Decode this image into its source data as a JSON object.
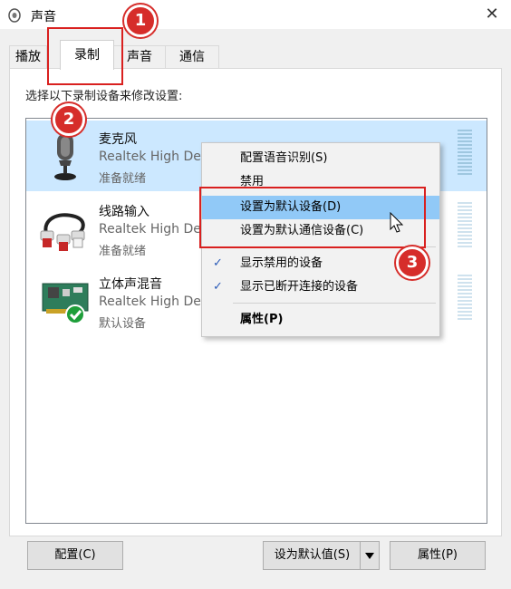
{
  "window": {
    "title": "声音",
    "close_glyph": "✕",
    "icon": "speaker-icon"
  },
  "tabs": [
    {
      "label": "播放",
      "active": false
    },
    {
      "label": "录制",
      "active": true
    },
    {
      "label": "声音",
      "active": false
    },
    {
      "label": "通信",
      "active": false
    }
  ],
  "instruction": "选择以下录制设备来修改设置:",
  "devices": [
    {
      "name": "麦克风",
      "description": "Realtek High Definition Audio",
      "status": "准备就绪",
      "icon": "microphone-icon",
      "selected": true
    },
    {
      "name": "线路输入",
      "description": "Realtek High Definition Audio",
      "status": "准备就绪",
      "icon": "line-in-cable-icon",
      "selected": false
    },
    {
      "name": "立体声混音",
      "description": "Realtek High Definition Audio",
      "status": "默认设备",
      "icon": "sound-card-icon",
      "selected": false,
      "default_check": true
    }
  ],
  "context_menu": {
    "items": [
      {
        "label": "配置语音识别(S)"
      },
      {
        "label": "禁用"
      },
      {
        "label": "设置为默认设备(D)",
        "highlighted": true
      },
      {
        "label": "设置为默认通信设备(C)"
      },
      {
        "label": "显示禁用的设备",
        "checked": true
      },
      {
        "label": "显示已断开连接的设备",
        "checked": true
      },
      {
        "label": "属性(P)",
        "bold": true
      }
    ],
    "check_glyph": "✓"
  },
  "buttons": {
    "configure": "配置(C)",
    "set_default": "设为默认值(S)",
    "properties": "属性(P)"
  },
  "annotations": {
    "step1": "1",
    "step2": "2",
    "step3": "3",
    "color": "#d9201f"
  }
}
